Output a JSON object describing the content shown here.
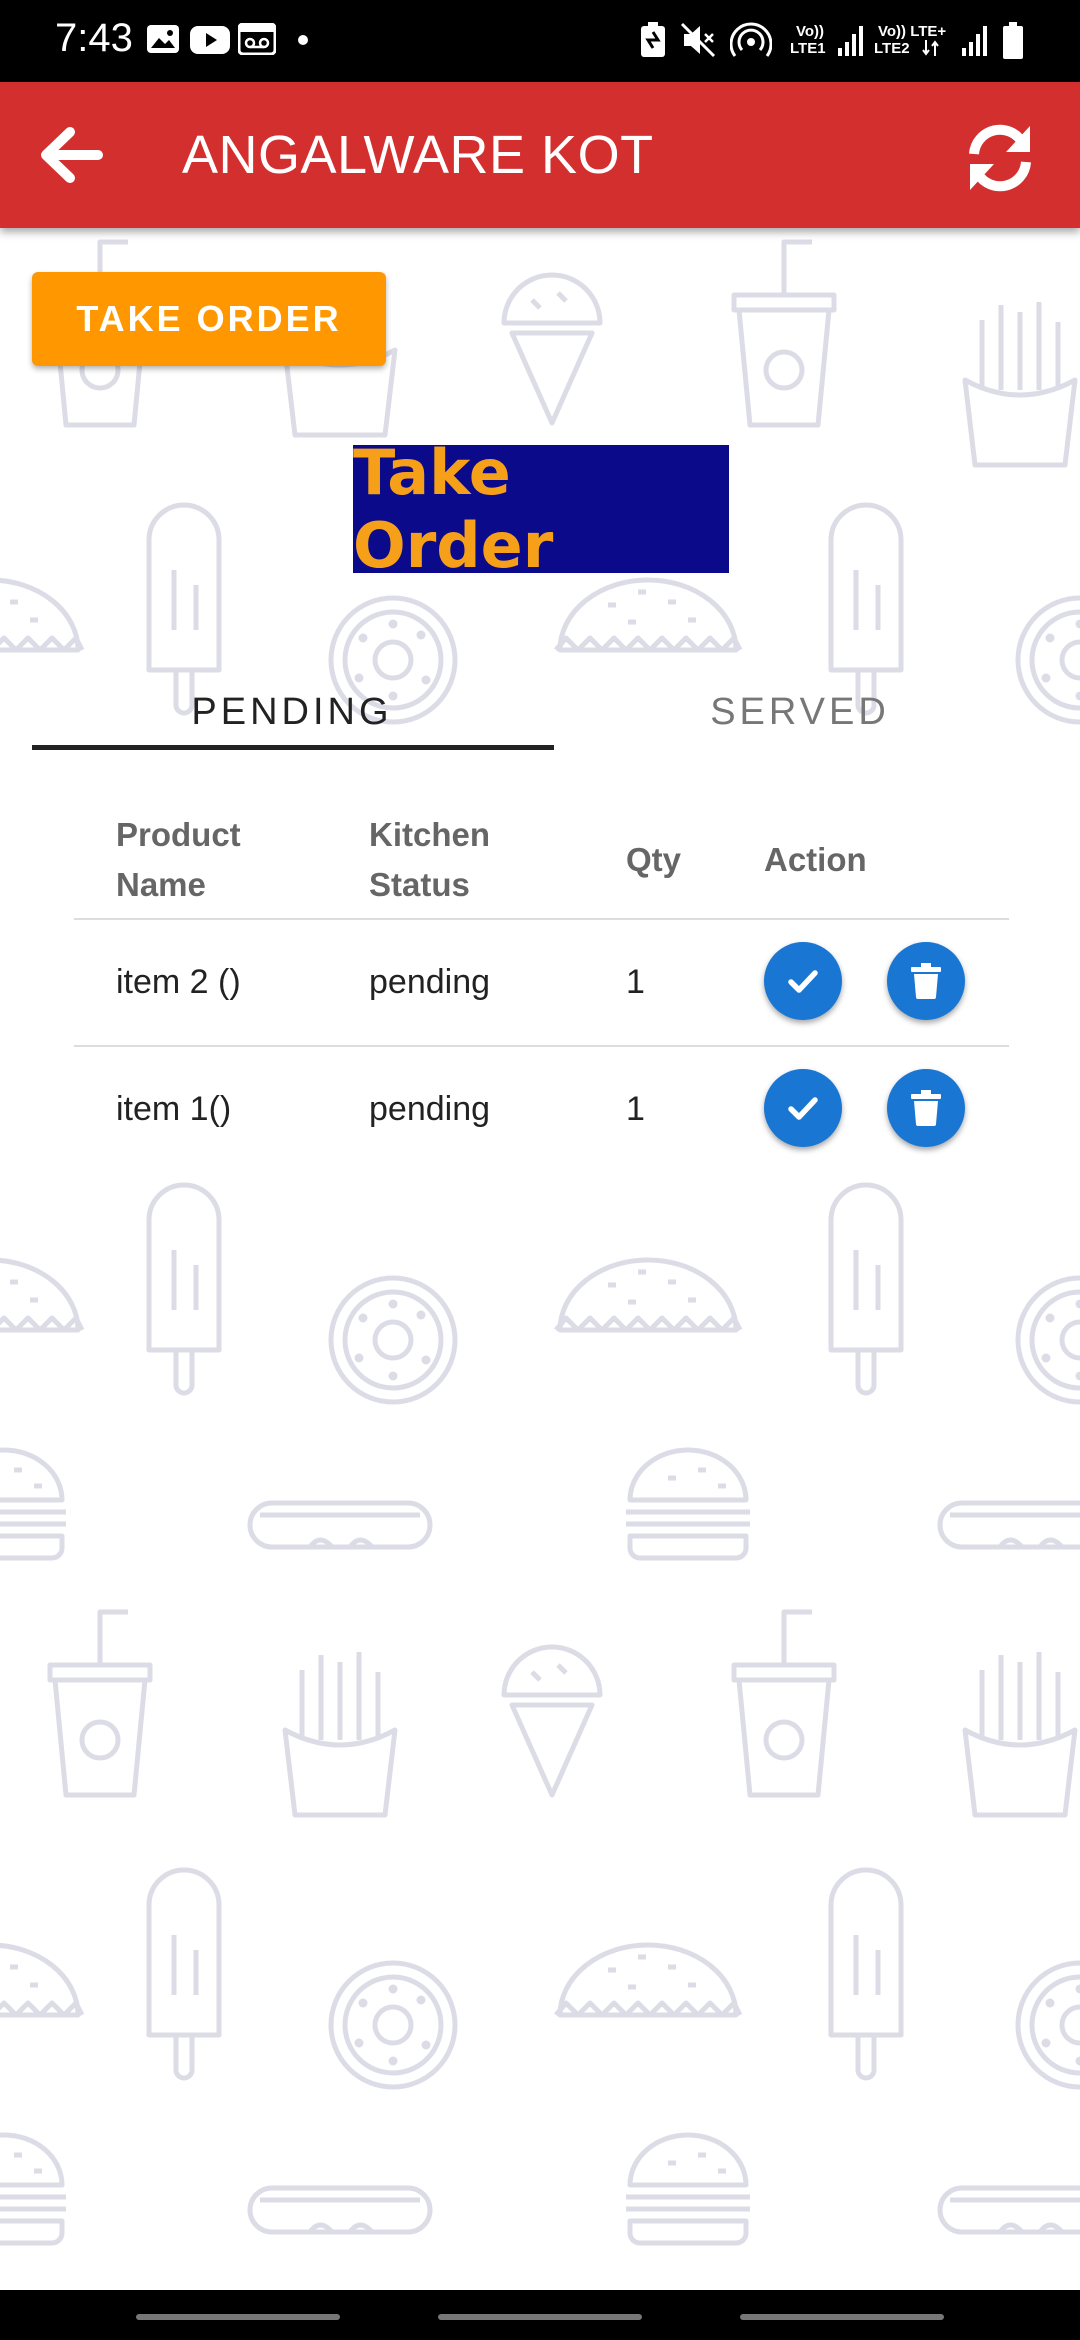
{
  "status_bar": {
    "time": "7:43",
    "sim1_label_top": "Vo))",
    "sim1_label_bottom": "LTE1",
    "sim2_label_top": "Vo)) LTE+",
    "sim2_label_bottom": "LTE2"
  },
  "app_bar": {
    "title": "ANGALWARE KOT",
    "back_icon": "arrow-left-icon",
    "refresh_icon": "sync-icon",
    "color": "#d32f2f"
  },
  "take_order_button": {
    "label": "TAKE ORDER",
    "color": "#ff9800"
  },
  "heading": {
    "text": "Take Order",
    "background": "#0a0a8a",
    "color": "#f6a01a"
  },
  "tabs": [
    {
      "label": "PENDING",
      "selected": true
    },
    {
      "label": "SERVED",
      "selected": false
    }
  ],
  "table": {
    "columns": {
      "product_name_line1": "Product",
      "product_name_line2": "Name",
      "kitchen_status_line1": "Kitchen",
      "kitchen_status_line2": "Status",
      "qty": "Qty",
      "action": "Action"
    },
    "rows": [
      {
        "product": "item 2 ()",
        "status": "pending",
        "qty": "1"
      },
      {
        "product": "item 1()",
        "status": "pending",
        "qty": "1"
      }
    ],
    "action_icons": [
      "check-icon",
      "trash-icon"
    ],
    "action_color": "#1976d2"
  }
}
